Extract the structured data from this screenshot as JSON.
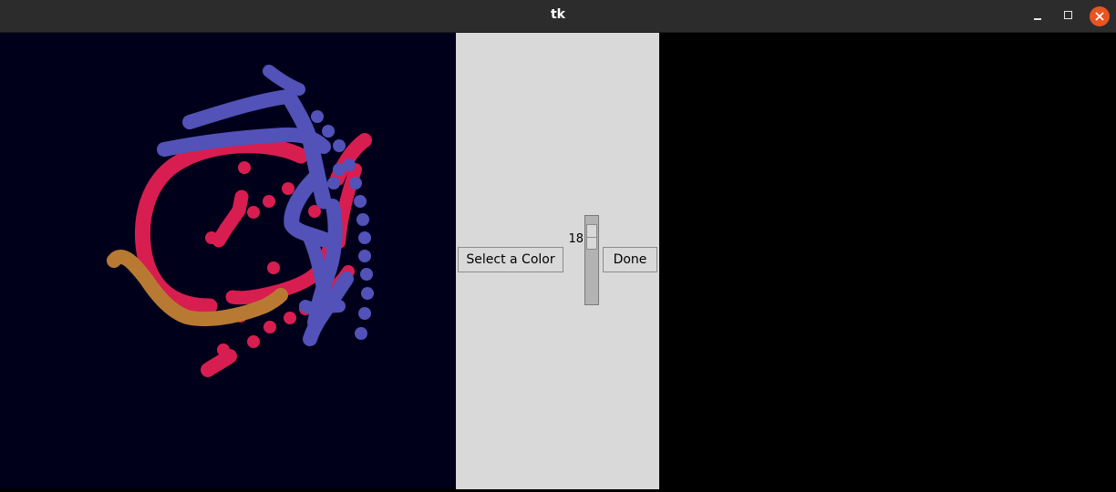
{
  "window": {
    "title": "tk",
    "controls": [
      "minimize-icon",
      "maximize-icon",
      "close-icon"
    ],
    "close_color": "#e95420"
  },
  "canvas_left": {
    "background": "#00001b",
    "stroke_colors": [
      "#d81e50",
      "#5252b8",
      "#b87a32"
    ]
  },
  "controls": {
    "select_color_label": "Select a Color",
    "scale_value": "18",
    "done_label": "Done"
  },
  "canvas_right": {
    "background": "#000000"
  }
}
